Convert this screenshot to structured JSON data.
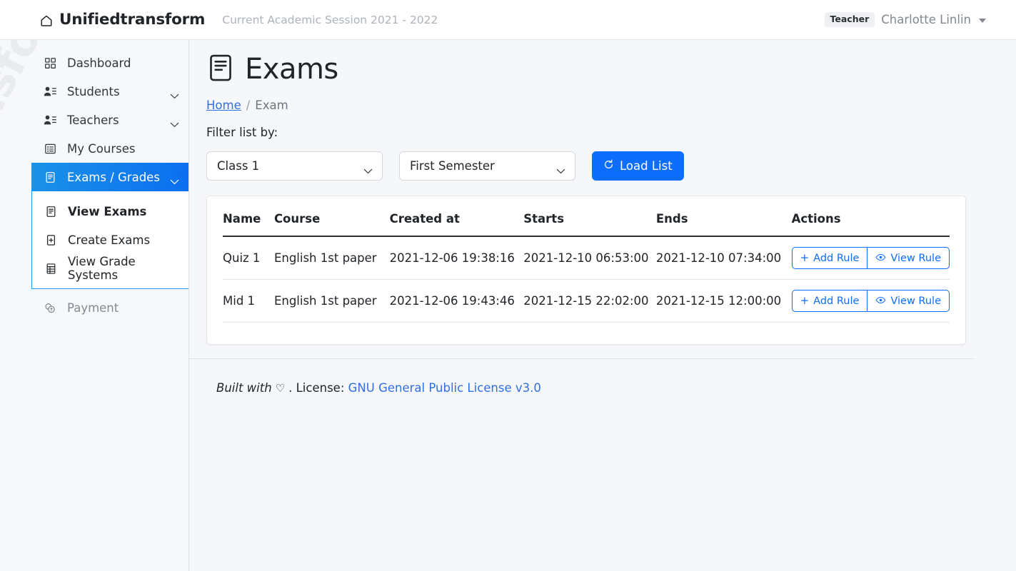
{
  "topbar": {
    "brand": "Unifiedtransform",
    "brand_icon": "home-icon",
    "session": "Current Academic Session 2021 - 2022",
    "role_badge": "Teacher",
    "user_name": "Charlotte Linlin",
    "caret_icon": "caret-down-icon"
  },
  "sidebar": {
    "watermark": "nsform",
    "items": [
      {
        "label": "Dashboard",
        "icon": "grid-icon",
        "expandable": false,
        "active": false,
        "muted": false
      },
      {
        "label": "Students",
        "icon": "people-icon",
        "expandable": true,
        "active": false,
        "muted": false
      },
      {
        "label": "Teachers",
        "icon": "people-icon",
        "expandable": true,
        "active": false,
        "muted": false
      },
      {
        "label": "My Courses",
        "icon": "card-list-icon",
        "expandable": false,
        "active": false,
        "muted": false
      },
      {
        "label": "Exams / Grades",
        "icon": "journal-icon",
        "expandable": true,
        "active": true,
        "muted": false
      }
    ],
    "submenu": [
      {
        "label": "View Exams",
        "icon": "journal-icon",
        "current": true
      },
      {
        "label": "Create Exams",
        "icon": "file-plus-icon",
        "current": false
      },
      {
        "label": "View Grade Systems",
        "icon": "table-icon",
        "current": false
      }
    ],
    "payment": {
      "label": "Payment",
      "icon": "coins-icon"
    }
  },
  "page": {
    "title": "Exams",
    "title_icon": "exam-document-icon",
    "breadcrumb": {
      "home": "Home",
      "separator": "/",
      "current": "Exam"
    },
    "filter_label": "Filter list by:"
  },
  "filters": {
    "class_select": {
      "value": "Class 1",
      "chevron": "chevron-down-icon"
    },
    "semester_select": {
      "value": "First Semester",
      "chevron": "chevron-down-icon"
    },
    "load_button": {
      "label": "Load List",
      "icon": "reload-icon"
    }
  },
  "table": {
    "columns": [
      "Name",
      "Course",
      "Created at",
      "Starts",
      "Ends",
      "Actions"
    ],
    "rows": [
      {
        "name": "Quiz 1",
        "course": "English 1st paper",
        "created_at": "2021-12-06 19:38:16",
        "starts": "2021-12-10 06:53:00",
        "ends": "2021-12-10 07:34:00",
        "add_rule": "Add Rule",
        "view_rule": "View Rule"
      },
      {
        "name": "Mid 1",
        "course": "English 1st paper",
        "created_at": "2021-12-06 19:43:46",
        "starts": "2021-12-15 22:02:00",
        "ends": "2021-12-15 12:00:00",
        "add_rule": "Add Rule",
        "view_rule": "View Rule"
      }
    ],
    "action_icons": {
      "add": "plus-icon",
      "view": "eye-icon"
    }
  },
  "footer": {
    "built_with": "Built with",
    "heart_icon": "heart-outline-icon",
    "license_prefix": ". License:",
    "license_link": "GNU General Public License v3.0"
  },
  "colors": {
    "accent_blue": "#0d6efd",
    "active_gradient_start": "#1b92e8",
    "active_gradient_end": "#0b6ef0",
    "link_blue": "#2f6fe4",
    "page_bg": "#f6f7f9",
    "sidebar_bg": "#f7f8fa",
    "muted_text": "#838a93"
  }
}
